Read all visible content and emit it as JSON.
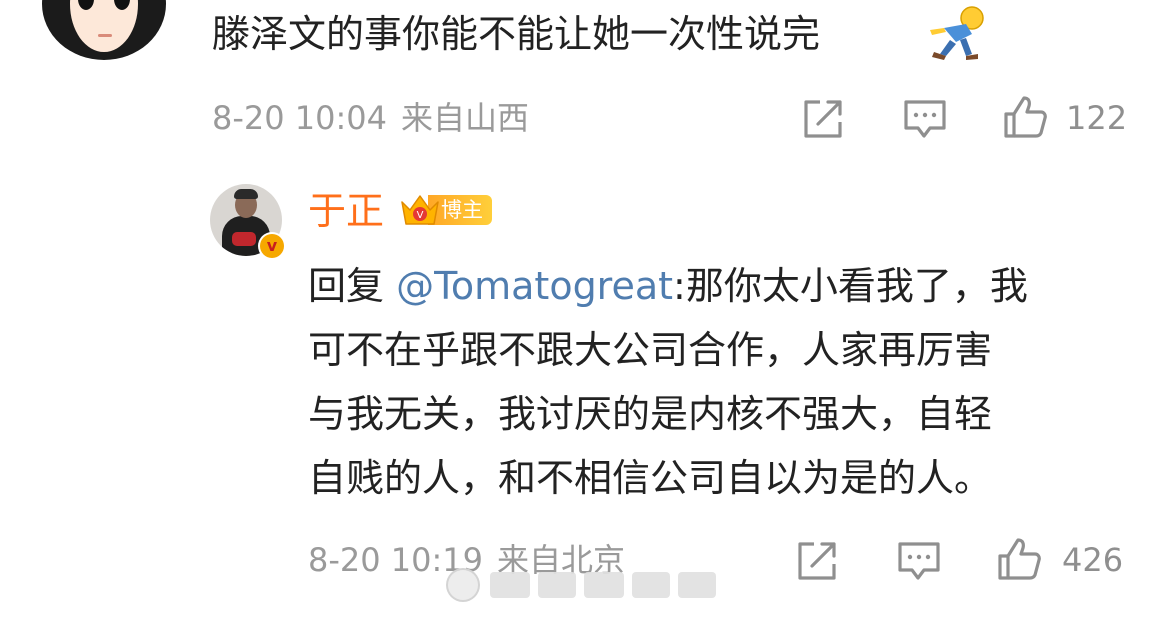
{
  "top_comment": {
    "text": "滕泽文的事你能不能让她一次性说完",
    "emoji": "running-man-emoji",
    "date": "8-20 10:04",
    "location": "来自山西",
    "like_count": "122"
  },
  "reply": {
    "user_name": "于正",
    "badge_label": "博主",
    "verified_mark": "v",
    "prefix": "回复",
    "mention": "@Tomatogreat",
    "lines": [
      ":那你太小看我了，我",
      "可不在乎跟不跟大公司合作，人家再厉害",
      "与我无关，我讨厌的是内核不强大，自轻",
      "自贱的人，和不相信公司自以为是的人。"
    ],
    "date": "8-20 10:19",
    "location": "来自北京",
    "like_count": "426"
  },
  "icons": {
    "share": "share-icon",
    "comment": "comment-icon",
    "like": "thumbs-up-icon"
  },
  "colors": {
    "user_name": "#ff6f1a",
    "mention": "#507daf",
    "meta": "#9a9a9a",
    "badge": "#ffa726"
  }
}
